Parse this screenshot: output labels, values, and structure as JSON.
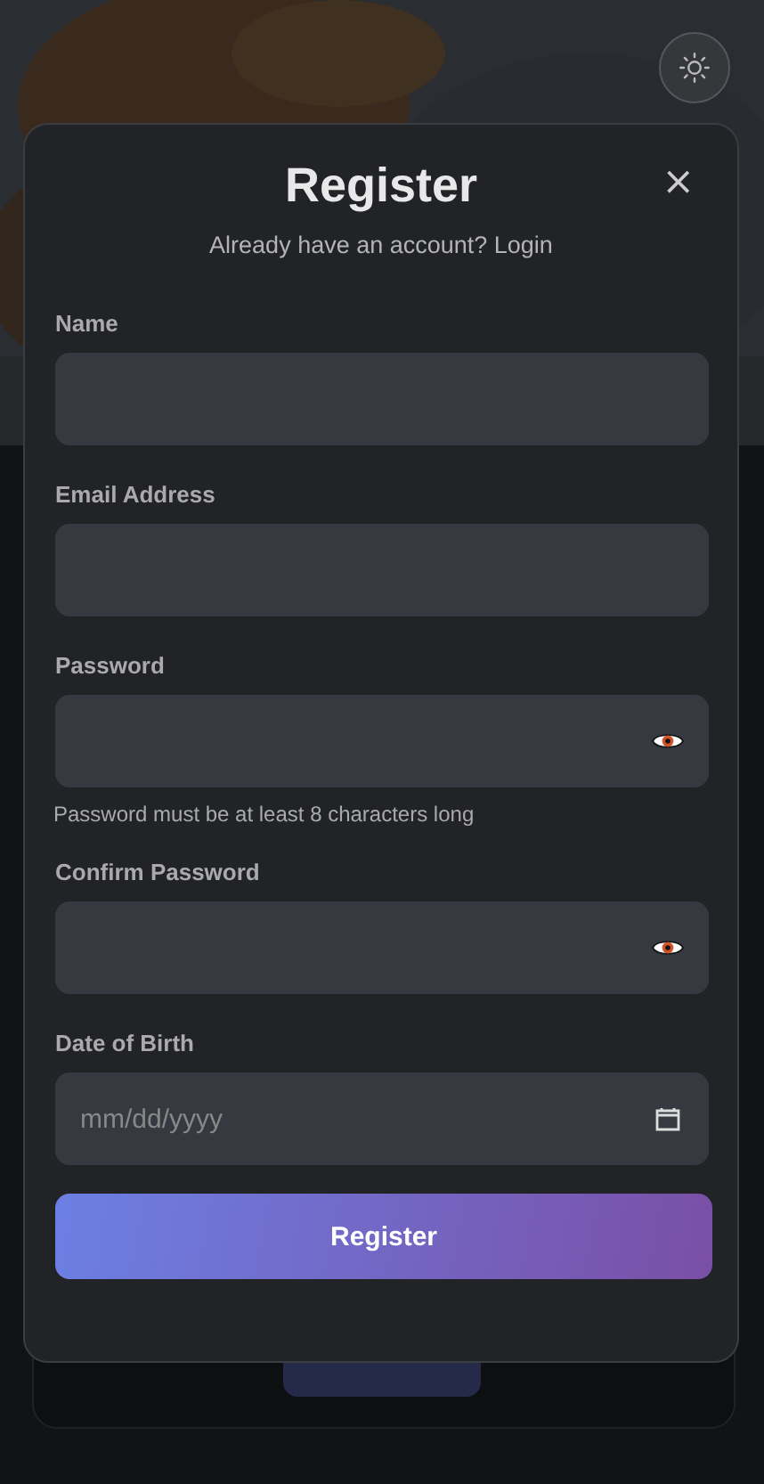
{
  "modal": {
    "title": "Register",
    "subtitle": "Already have an account? Login",
    "close": "×",
    "fields": [
      {
        "kind": "text",
        "label": "Name"
      },
      {
        "kind": "text",
        "label": "Email Address"
      },
      {
        "kind": "password",
        "label": "Password",
        "hint": "Password must be at least 8 characters long"
      },
      {
        "kind": "password",
        "label": "Confirm Password"
      },
      {
        "kind": "date",
        "label": "Date of Birth",
        "placeholder": "mm/dd/yyyy"
      }
    ],
    "submit": "Register"
  }
}
